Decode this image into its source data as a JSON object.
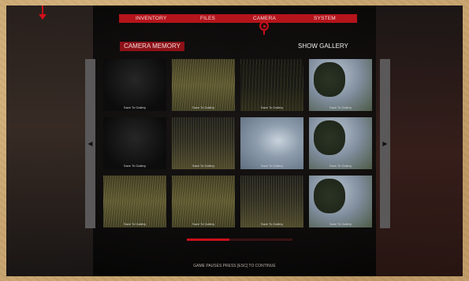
{
  "tabs": [
    {
      "label": "INVENTORY",
      "active": false
    },
    {
      "label": "FILES",
      "active": false
    },
    {
      "label": "CAMERA",
      "active": true
    },
    {
      "label": "SYSTEM",
      "active": false
    }
  ],
  "panel": {
    "section_label": "CAMERA MEMORY",
    "gallery_label": "SHOW GALLERY"
  },
  "thumbnails": [
    {
      "caption": "Save To Gallery",
      "scene": "dark"
    },
    {
      "caption": "Save To Gallery",
      "scene": "grass"
    },
    {
      "caption": "Save To Gallery",
      "scene": "dim-grass"
    },
    {
      "caption": "Save To Gallery",
      "scene": "sky-tree"
    },
    {
      "caption": "Save To Gallery",
      "scene": "dark"
    },
    {
      "caption": "Save To Gallery",
      "scene": "field"
    },
    {
      "caption": "Save To Gallery",
      "scene": "sky"
    },
    {
      "caption": "Save To Gallery",
      "scene": "sky-tree"
    },
    {
      "caption": "Save To Gallery",
      "scene": "grass"
    },
    {
      "caption": "Save To Gallery",
      "scene": "grass"
    },
    {
      "caption": "Save To Gallery",
      "scene": "field"
    },
    {
      "caption": "Save To Gallery",
      "scene": "sky-tree"
    }
  ],
  "pager": {
    "progress": 0.4
  },
  "footer": {
    "hint": "GAME PAUSES PRESS [ESC] TO CONTINUE"
  },
  "icons": {
    "left": "chevron-left-icon",
    "right": "chevron-right-icon",
    "camera": "camera-lens-icon",
    "marker": "arrow-down-icon"
  },
  "colors": {
    "accent": "#b5141b",
    "accent_dark": "#8c1117"
  }
}
